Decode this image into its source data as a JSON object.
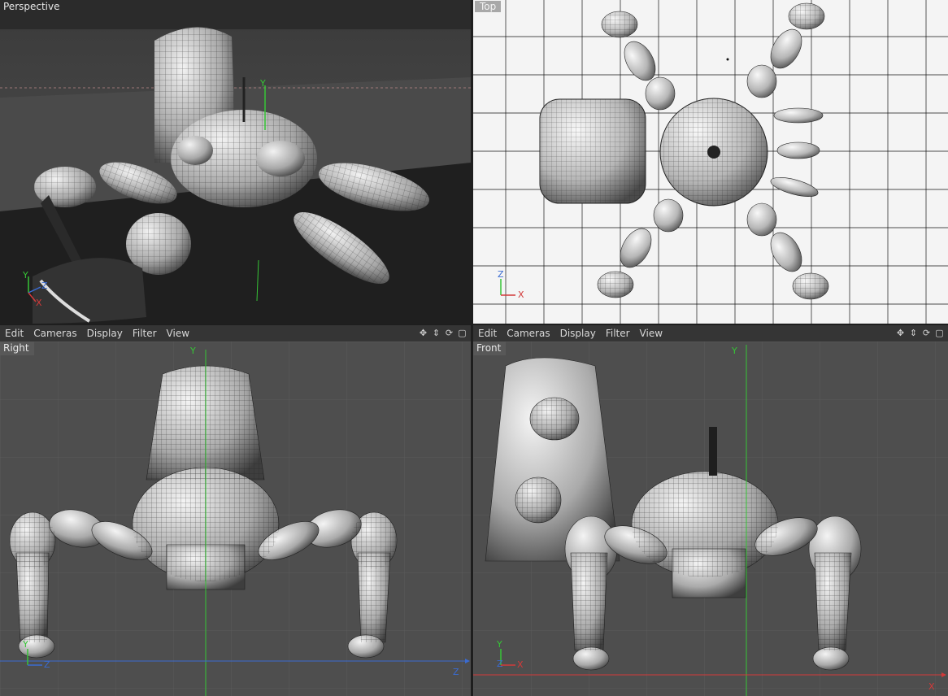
{
  "viewports": {
    "perspective": {
      "label": "Perspective"
    },
    "top": {
      "label": "Top"
    },
    "right": {
      "label": "Right"
    },
    "front": {
      "label": "Front"
    }
  },
  "menu": {
    "left": [
      "Edit",
      "Cameras",
      "Display",
      "Filter",
      "View"
    ],
    "right": [
      "Edit",
      "Cameras",
      "Display",
      "Filter",
      "View"
    ]
  },
  "axes": {
    "x": "X",
    "y": "Y",
    "z": "Z"
  },
  "icons": [
    "move-icon",
    "dolly-icon",
    "rotate-icon",
    "maximize-icon"
  ],
  "colors": {
    "background": "#4e4e4e",
    "grid": "#5c5c5c",
    "top_background": "#f4f4f4",
    "axis_green": "#36c536",
    "axis_red": "#d23a3a",
    "axis_blue": "#3a6bd2"
  }
}
